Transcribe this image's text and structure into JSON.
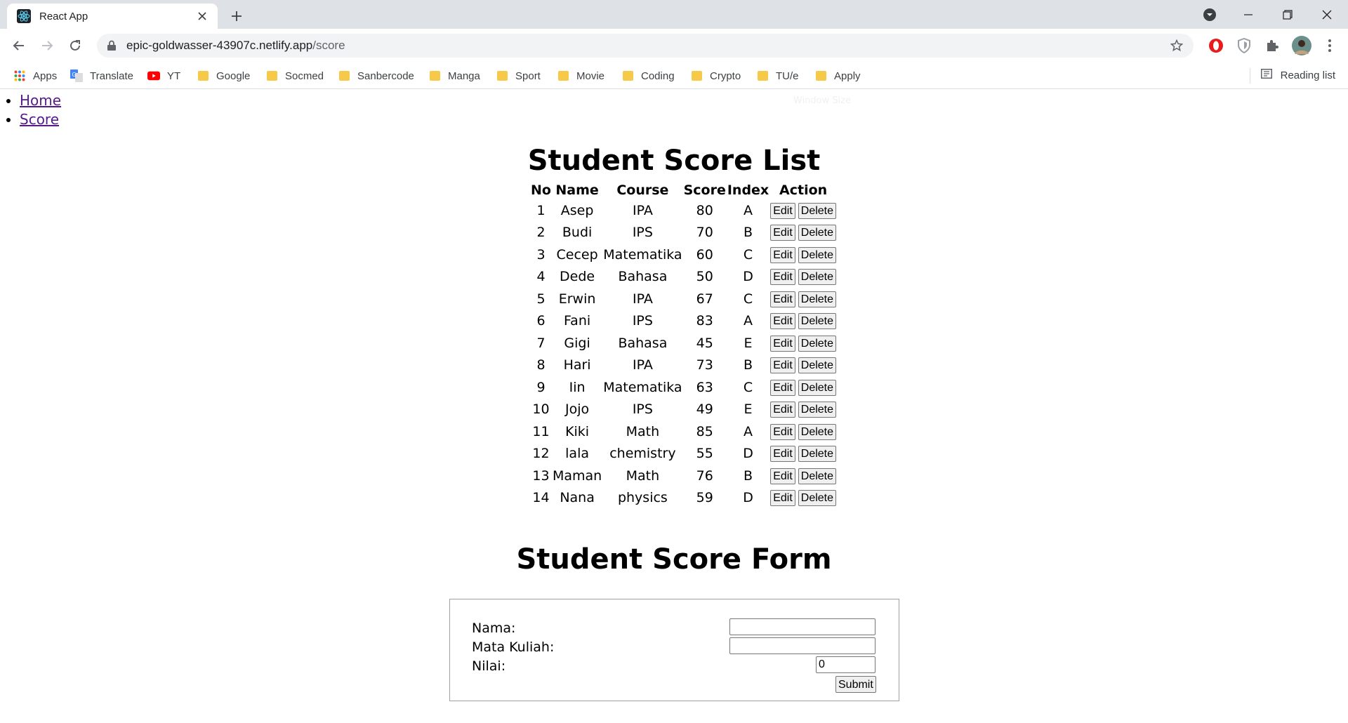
{
  "browser": {
    "tab_title": "React App",
    "url_host": "epic-goldwasser-43907c.netlify.app",
    "url_path": "/score",
    "bookmarks": [
      {
        "label": "Apps",
        "icon": "apps-grid-icon"
      },
      {
        "label": "Translate",
        "icon": "translate-icon"
      },
      {
        "label": "YT",
        "icon": "youtube-icon"
      },
      {
        "label": "Google",
        "icon": "folder-icon"
      },
      {
        "label": "Socmed",
        "icon": "folder-icon"
      },
      {
        "label": "Sanbercode",
        "icon": "folder-icon"
      },
      {
        "label": "Manga",
        "icon": "folder-icon"
      },
      {
        "label": "Sport",
        "icon": "folder-icon"
      },
      {
        "label": "Movie",
        "icon": "folder-icon"
      },
      {
        "label": "Coding",
        "icon": "folder-icon"
      },
      {
        "label": "Crypto",
        "icon": "folder-icon"
      },
      {
        "label": "TU/e",
        "icon": "folder-icon"
      },
      {
        "label": "Apply",
        "icon": "folder-icon"
      }
    ],
    "reading_list": "Reading list"
  },
  "nav": {
    "links": [
      "Home",
      "Score"
    ]
  },
  "faint_overlay_text": "Window Size",
  "list": {
    "title": "Student Score List",
    "headers": [
      "No",
      "Name",
      "Course",
      "Score",
      "Index",
      "Action"
    ],
    "edit_label": "Edit",
    "delete_label": "Delete",
    "rows": [
      {
        "no": "1",
        "name": "Asep",
        "course": "IPA",
        "score": "80",
        "index": "A"
      },
      {
        "no": "2",
        "name": "Budi",
        "course": "IPS",
        "score": "70",
        "index": "B"
      },
      {
        "no": "3",
        "name": "Cecep",
        "course": "Matematika",
        "score": "60",
        "index": "C"
      },
      {
        "no": "4",
        "name": "Dede",
        "course": "Bahasa",
        "score": "50",
        "index": "D"
      },
      {
        "no": "5",
        "name": "Erwin",
        "course": "IPA",
        "score": "67",
        "index": "C"
      },
      {
        "no": "6",
        "name": "Fani",
        "course": "IPS",
        "score": "83",
        "index": "A"
      },
      {
        "no": "7",
        "name": "Gigi",
        "course": "Bahasa",
        "score": "45",
        "index": "E"
      },
      {
        "no": "8",
        "name": "Hari",
        "course": "IPA",
        "score": "73",
        "index": "B"
      },
      {
        "no": "9",
        "name": "Iin",
        "course": "Matematika",
        "score": "63",
        "index": "C"
      },
      {
        "no": "10",
        "name": "Jojo",
        "course": "IPS",
        "score": "49",
        "index": "E"
      },
      {
        "no": "11",
        "name": "Kiki",
        "course": "Math",
        "score": "85",
        "index": "A"
      },
      {
        "no": "12",
        "name": "lala",
        "course": "chemistry",
        "score": "55",
        "index": "D"
      },
      {
        "no": "13",
        "name": "Maman",
        "course": "Math",
        "score": "76",
        "index": "B"
      },
      {
        "no": "14",
        "name": "Nana",
        "course": "physics",
        "score": "59",
        "index": "D"
      }
    ]
  },
  "form": {
    "title": "Student Score Form",
    "nama_label": "Nama:",
    "nama_value": "",
    "mata_kuliah_label": "Mata Kuliah:",
    "mata_kuliah_value": "",
    "nilai_label": "Nilai:",
    "nilai_value": "0",
    "submit_label": "Submit"
  },
  "colors": {
    "link_visited": "#551a8b",
    "tabstrip_bg": "#dee1e6",
    "folder": "#f7c948"
  }
}
